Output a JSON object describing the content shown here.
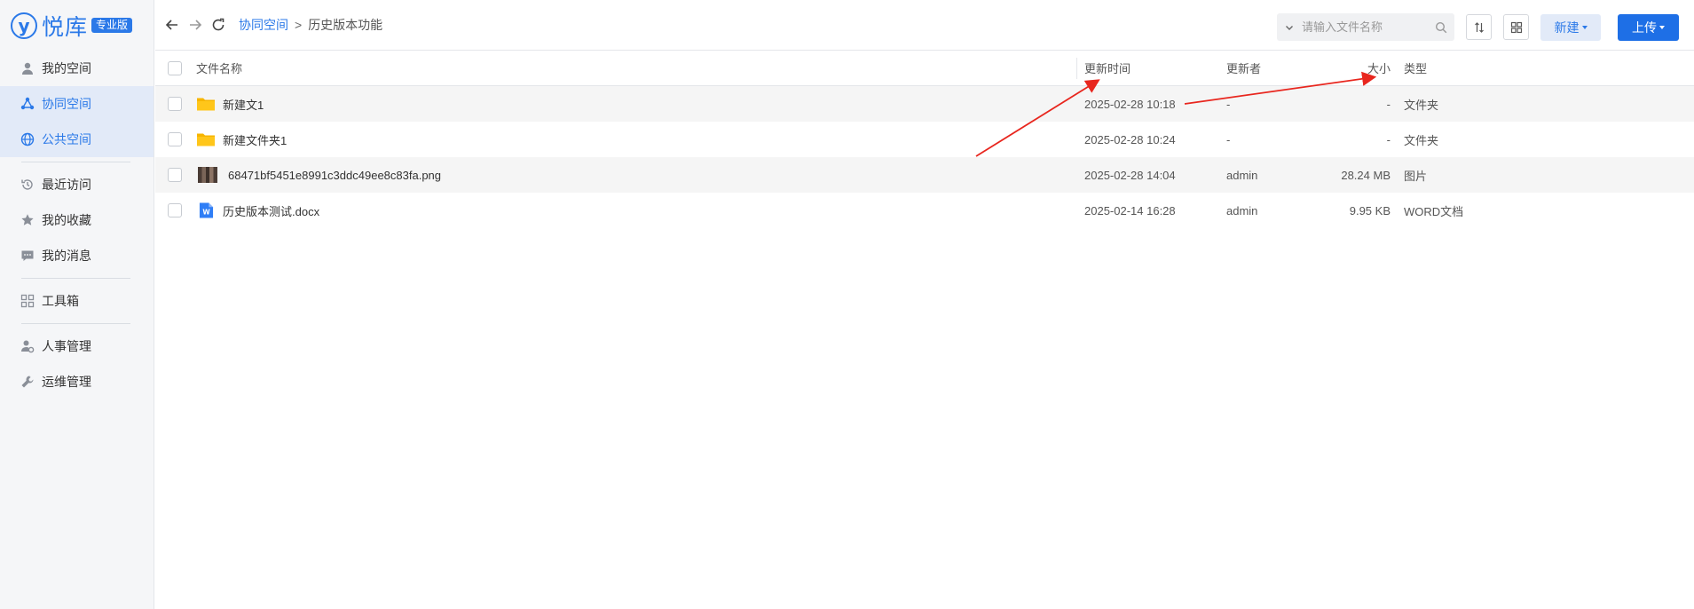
{
  "brand": {
    "logo_mark": "y",
    "name": "悦库",
    "badge": "专业版",
    "color": "#2b79e8"
  },
  "sidebar": {
    "groups": [
      [
        {
          "label": "我的空间",
          "icon": "user-icon"
        },
        {
          "label": "协同空间",
          "icon": "share-nodes-icon",
          "active": true
        },
        {
          "label": "公共空间",
          "icon": "globe-icon",
          "active": true
        }
      ],
      [
        {
          "label": "最近访问",
          "icon": "history-icon"
        },
        {
          "label": "我的收藏",
          "icon": "star-icon"
        },
        {
          "label": "我的消息",
          "icon": "message-icon"
        }
      ],
      [
        {
          "label": "工具箱",
          "icon": "grid-icon"
        }
      ],
      [
        {
          "label": "人事管理",
          "icon": "user-gear-icon"
        },
        {
          "label": "运维管理",
          "icon": "wrench-icon"
        }
      ]
    ]
  },
  "topbar": {
    "breadcrumb": {
      "link": "协同空间",
      "separator": ">",
      "current": "历史版本功能"
    },
    "search_placeholder": "请输入文件名称",
    "new_label": "新建",
    "upload_label": "上传"
  },
  "table": {
    "headers": {
      "name": "文件名称",
      "time": "更新时间",
      "updater": "更新者",
      "size": "大小",
      "type": "类型"
    },
    "rows": [
      {
        "name": "新建文1",
        "time": "2025-02-28 10:18",
        "updater": "-",
        "size": "-",
        "type": "文件夹",
        "icon": "folder-icon"
      },
      {
        "name": "新建文件夹1",
        "time": "2025-02-28 10:24",
        "updater": "-",
        "size": "-",
        "type": "文件夹",
        "icon": "folder-icon"
      },
      {
        "name": "68471bf5451e8991c3ddc49ee8c83fa.png",
        "time": "2025-02-28 14:04",
        "updater": "admin",
        "size": "28.24 MB",
        "type": "图片",
        "icon": "image-thumbnail"
      },
      {
        "name": "历史版本测试.docx",
        "time": "2025-02-14 16:28",
        "updater": "admin",
        "size": "9.95 KB",
        "type": "WORD文档",
        "icon": "word-doc-icon"
      }
    ]
  },
  "colors": {
    "accent": "#2b79e8",
    "upload_button": "#1e6fe6",
    "folder": "#f7b500",
    "annotation_arrow": "#e8261e"
  }
}
